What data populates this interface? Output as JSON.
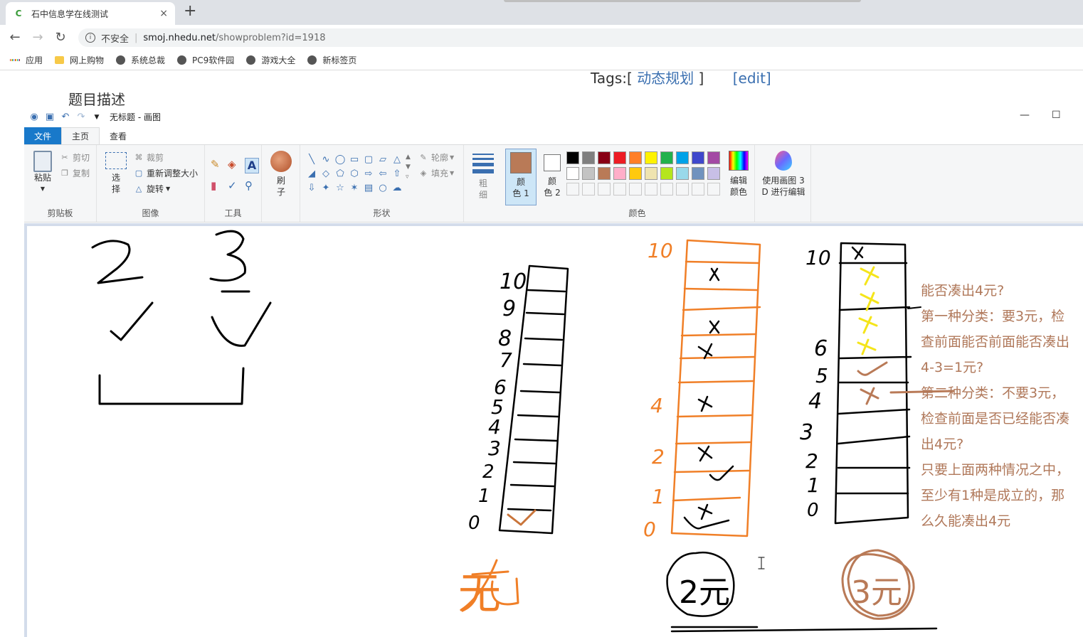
{
  "browser": {
    "tab_favicon": "C",
    "tab_title": "石中信息学在线测试",
    "close": "×",
    "new_tab": "+",
    "insecure": "不安全",
    "url_domain": "smoj.nhedu.net",
    "url_path": "/showproblem?id=1918",
    "bookmarks": [
      "应用",
      "网上购物",
      "系统总裁",
      "PC9软件园",
      "游戏大全",
      "新标签页"
    ]
  },
  "page": {
    "tags_prefix": "Tags:[",
    "tag": "动态规划",
    "tags_suffix": "]",
    "edit": "[edit]",
    "section_title": "题目描述"
  },
  "paint": {
    "window_title": "无标题 - 画图",
    "tabs": {
      "file": "文件",
      "home": "主页",
      "view": "查看"
    },
    "clipboard": {
      "paste": "粘贴",
      "cut": "剪切",
      "copy": "复制",
      "label": "剪贴板"
    },
    "image": {
      "select_1": "选",
      "select_2": "择",
      "crop": "裁剪",
      "resize": "重新调整大小",
      "rotate": "旋转",
      "label": "图像"
    },
    "tools": {
      "label": "工具"
    },
    "brush": {
      "line1": "刷",
      "line2": "子"
    },
    "shapes": {
      "outline": "轮廓",
      "fill": "填充",
      "label": "形状"
    },
    "size": {
      "line1": "粗",
      "line2": "细"
    },
    "color1": {
      "line1": "颜",
      "line2": "色 1"
    },
    "color2": {
      "line1": "颜",
      "line2": "色 2"
    },
    "edit_colors": {
      "line1": "编辑",
      "line2": "颜色"
    },
    "colors_label": "颜色",
    "paint3d": {
      "line1": "使用画图 3",
      "line2": "D 进行编辑"
    },
    "color1_value": "#b97a57",
    "palette": [
      "#000000",
      "#7f7f7f",
      "#880015",
      "#ed1c24",
      "#ff7f27",
      "#fff200",
      "#22b14c",
      "#00a2e8",
      "#3f48cc",
      "#a349a4",
      "#ffffff",
      "#c3c3c3",
      "#b97a57",
      "#ffaec9",
      "#ffc90e",
      "#efe4b0",
      "#b5e61d",
      "#99d9ea",
      "#7092be",
      "#c8bfe7"
    ]
  },
  "canvas": {
    "notes": [
      "能否凑出4元?",
      "第一种分类：要3元，检",
      "查前面能否前面能否凑出",
      "4-3=1元?",
      "第二种分类：不要3元，",
      "检查前面是否已经能否凑",
      "出4元?",
      "只要上面两种情况之中，",
      "至少有1种是成立的，那",
      "么久能凑出4元"
    ],
    "handwriting": {
      "coin_a": "2",
      "coin_b": "3",
      "label_none": "无",
      "label_2yuan": "2元",
      "label_3yuan": "3元",
      "col1_numbers": [
        "10",
        "9",
        "8",
        "7",
        "6",
        "5",
        "4",
        "3",
        "2",
        "1",
        "0"
      ],
      "col2_numbers": [
        "10",
        "4",
        "2",
        "1",
        "0"
      ],
      "col3_numbers": [
        "10",
        "6",
        "5",
        "4",
        "3",
        "2",
        "1",
        "0"
      ]
    }
  }
}
